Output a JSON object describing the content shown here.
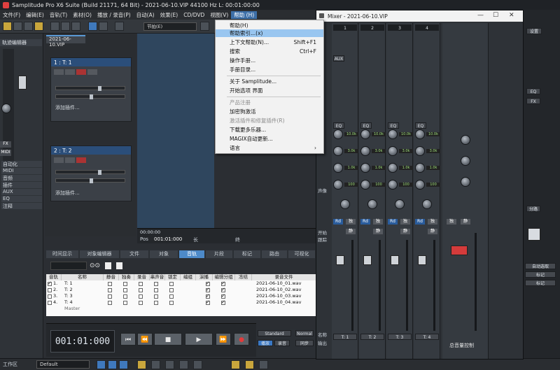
{
  "title": "Samplitude Pro X6 Suite (Build 21171, 64 Bit)  -  2021-06-10.VIP    44100 Hz L: 00:01:00:00",
  "menubar": [
    "文件(F)",
    "编辑(E)",
    "音轨(T)",
    "素材(O)",
    "播放 / 录音(P)",
    "自动(A)",
    "效果(E)",
    "CD/DVD",
    "视图(V)",
    "帮助 (H)"
  ],
  "toolbar": {
    "tempo_field": "节拍(E)"
  },
  "left_panel": {
    "title": "轨迹编辑器",
    "items": [
      "自动化",
      "MIDI",
      "音频",
      "插件",
      "AUX",
      "EQ",
      "注释"
    ],
    "fx": "FX",
    "midi": "MIDI",
    "rd": "Rd"
  },
  "project_tab": "2021-06-10.VIP",
  "tracks": [
    {
      "label": "1 : T: 1",
      "plugin": "添加插件..."
    },
    {
      "label": "2 : T: 2",
      "plugin": "添加插件..."
    }
  ],
  "arrangement": {
    "time": "00:00:00",
    "pos_label": "Pos",
    "pos_value": "001:01:000",
    "len_label": "长",
    "end_label": "终"
  },
  "help_menu": {
    "items": [
      {
        "label": "帮助(H)",
        "shortcut": "",
        "state": "normal"
      },
      {
        "label": "帮助索引...(x)",
        "shortcut": "",
        "state": "highlight"
      },
      {
        "label": "上下文帮助(N)...",
        "shortcut": "Shift+F1",
        "state": "normal"
      },
      {
        "label": "搜索",
        "shortcut": "Ctrl+F",
        "state": "normal"
      },
      {
        "label": "操作手册...",
        "shortcut": "",
        "state": "normal"
      },
      {
        "label": "手册目录...",
        "shortcut": "",
        "state": "normal"
      },
      {
        "label": "关于 Samplitude...",
        "shortcut": "",
        "state": "normal"
      },
      {
        "label": "开始选项 界面",
        "shortcut": "",
        "state": "normal"
      },
      {
        "label": "产品注册",
        "shortcut": "",
        "state": "disabled"
      },
      {
        "label": "加密狗激活",
        "shortcut": "",
        "state": "normal"
      },
      {
        "label": "激活插件和修复插件(R)",
        "shortcut": "",
        "state": "disabled"
      },
      {
        "label": "下载更多乐器...",
        "shortcut": "",
        "state": "normal"
      },
      {
        "label": "MAGIX自动更新...",
        "shortcut": "",
        "state": "normal"
      },
      {
        "label": "语言",
        "shortcut": "›",
        "state": "normal"
      }
    ]
  },
  "mixer": {
    "title": "Mixer - 2021-06-10.VIP",
    "settings": "设置",
    "channel_numbers": [
      "1",
      "2",
      "3",
      "4"
    ],
    "eq_label": "EQ",
    "fx_label": "FX",
    "aux_label": "AUX",
    "eq_values": [
      "10.0k",
      "3.0k",
      "1.0k",
      "100"
    ],
    "section_labels": [
      "声像",
      "开始跟踪"
    ],
    "strip_labels": [
      "T: 1",
      "T: 2",
      "T: 3",
      "T: 4"
    ],
    "rd": "Rd",
    "solo": "独",
    "mute": "静",
    "master_label": "总音量控制",
    "vca": "VCA",
    "vfx": "FX",
    "normal": "Normal",
    "standard": "Standard",
    "input_label": "名称",
    "output_label": "输出",
    "sync": "同步",
    "right": {
      "eq": "EQ",
      "fx": "FX",
      "link": "分路",
      "auto": "自动选取",
      "marker_a": "标记",
      "marker_b": "标记"
    },
    "db_scale": [
      "12",
      "6",
      "0",
      "5",
      "10",
      "20",
      "30",
      "40",
      "50",
      "60"
    ]
  },
  "bottom_tabs": [
    "时间显示",
    "对象编辑器",
    "文件",
    "对象",
    "音轨",
    "片段",
    "标记",
    "路由",
    "可视化"
  ],
  "track_table": {
    "headers": [
      "音轨",
      "名称",
      "静音",
      "独奏",
      "录音",
      "串声音",
      "锁定",
      "编组",
      "演播",
      "编辑分组",
      "冻结",
      "录音文件"
    ],
    "rows": [
      {
        "num": "1.",
        "name": "T: 1",
        "file": "2021-06-10_01.wav"
      },
      {
        "num": "2.",
        "name": "T: 2",
        "file": "2021-06-10_02.wav"
      },
      {
        "num": "3.",
        "name": "T: 3",
        "file": "2021-06-10_03.wav"
      },
      {
        "num": "4.",
        "name": "T: 4",
        "file": "2021-06-10_04.wav"
      },
      {
        "num": "",
        "name": "Master",
        "file": ""
      }
    ]
  },
  "transport": {
    "time": "001:01:000",
    "play": "播放",
    "record": "录音"
  },
  "status": {
    "workspace": "工作区",
    "preset": "Default"
  },
  "master_meter_label": "总音量控制"
}
